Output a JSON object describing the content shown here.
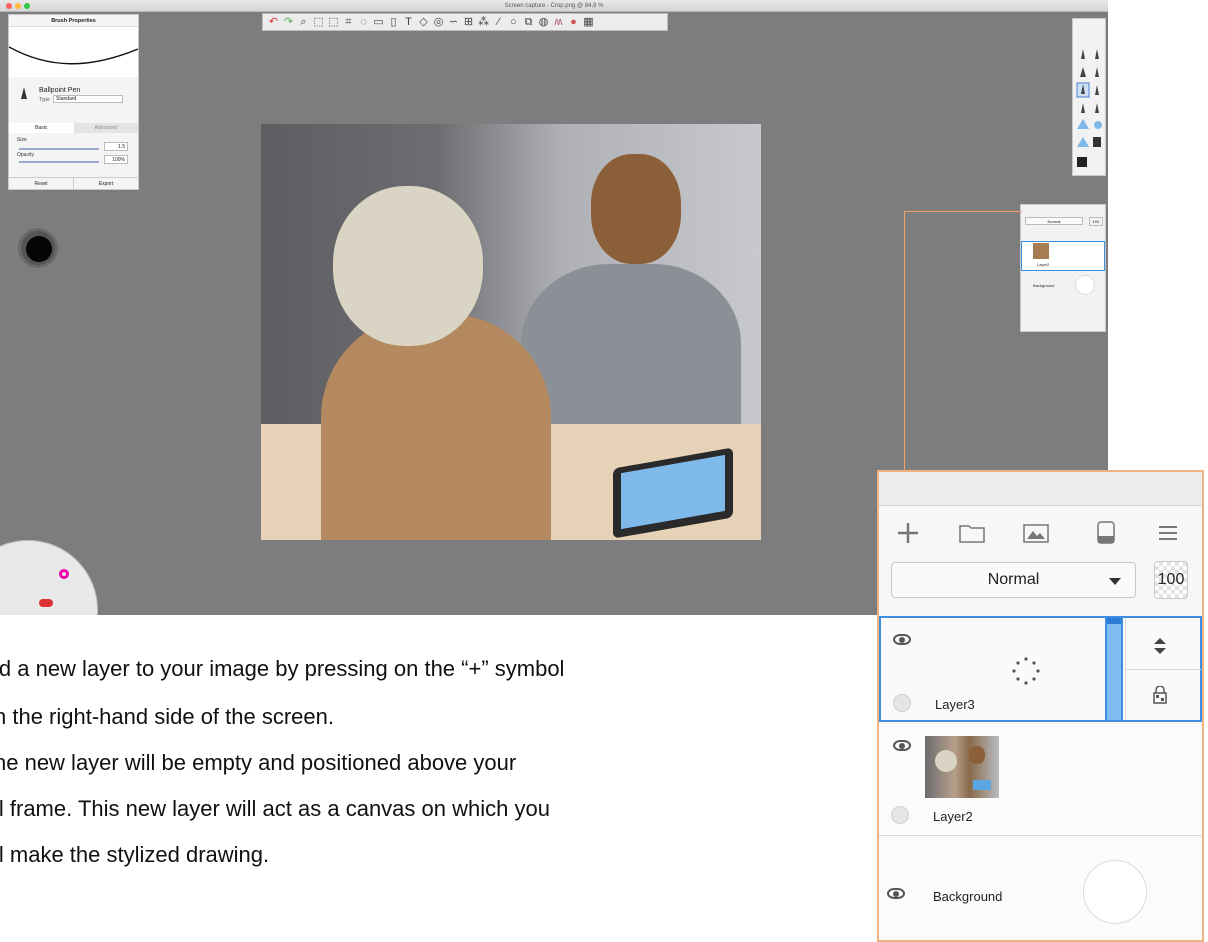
{
  "window": {
    "title": "Screen capture - Crop.png @ 84,8 %"
  },
  "brush_properties": {
    "title": "Brush Properties",
    "brush_name": "Ballpoint Pen",
    "type_label": "Type",
    "type_value": "Standard",
    "tabs": [
      "Basic",
      "Advanced"
    ],
    "size_label": "Size",
    "size_value": "1.5",
    "opacity_label": "Opacity",
    "opacity_value": "100%",
    "reset_label": "Reset",
    "export_label": "Export"
  },
  "mini_layers": {
    "blend_mode": "Normal",
    "opacity": "100",
    "layers": [
      "Layer2",
      "Background"
    ]
  },
  "instructions": {
    "line1": "ld a new layer to your image by pressing on the “+” symbol",
    "line2": "n the right-hand side of the screen.",
    "line3": "he new layer will be empty and positioned above your",
    "line4": "ll frame. This new layer will act as a canvas on which you",
    "line5": "ll make the stylized drawing."
  },
  "layers_panel": {
    "icons": [
      "add-layer-icon",
      "folder-icon",
      "image-icon",
      "save-layer-icon",
      "menu-icon"
    ],
    "blend_mode": "Normal",
    "opacity": "100",
    "layers": [
      {
        "name": "Layer3"
      },
      {
        "name": "Layer2"
      },
      {
        "name": "Background"
      }
    ]
  },
  "colors": {
    "accent_blue": "#3d8ee0",
    "highlight_orange": "#f2a16d",
    "canvas_gray": "#7d7d7d"
  }
}
